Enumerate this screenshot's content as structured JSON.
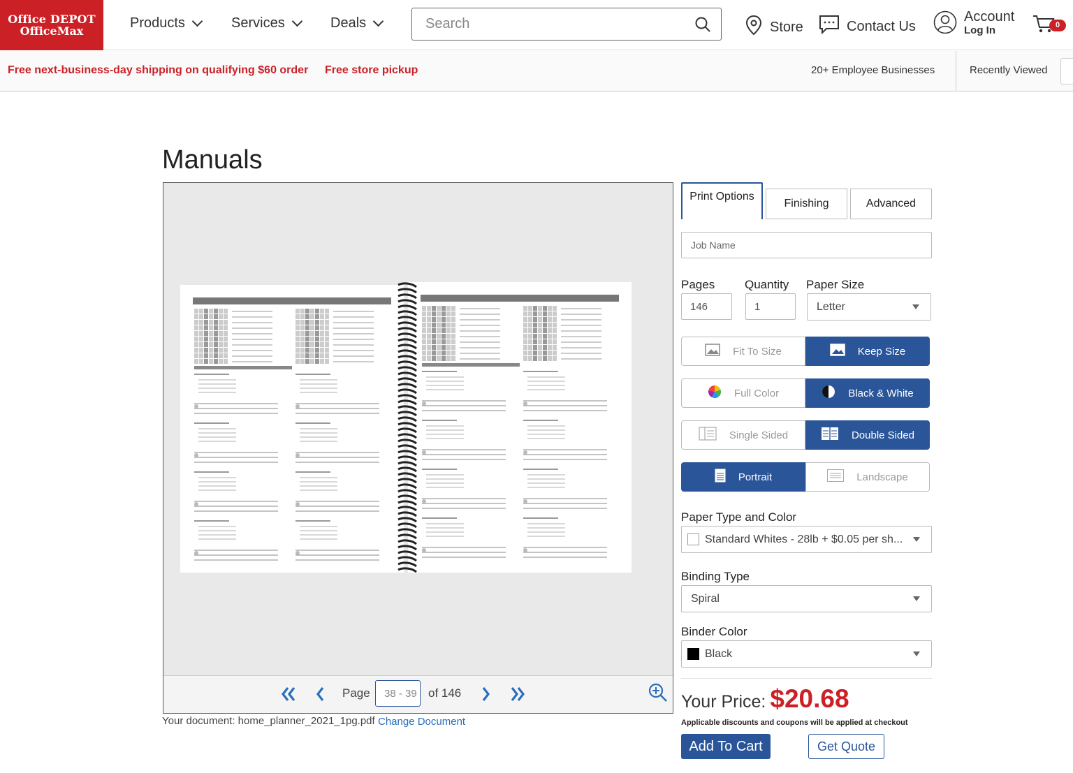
{
  "brand": {
    "line1": "Office DEPOT",
    "line2": "OfficeMax",
    "color": "#cc2027"
  },
  "nav": {
    "products": "Products",
    "services": "Services",
    "deals": "Deals"
  },
  "search": {
    "placeholder": "Search"
  },
  "header_links": {
    "store": "Store",
    "contact": "Contact Us",
    "account": "Account",
    "login": "Log In",
    "cart_count": "0"
  },
  "promo": {
    "shipping": "Free next-business-day shipping on qualifying $60 order",
    "pickup": "Free store pickup",
    "employee": "20+ Employee Businesses",
    "recent": "Recently Viewed"
  },
  "page": {
    "title": "Manuals"
  },
  "viewer": {
    "page_label": "Page",
    "page_value": "38 - 39",
    "of_label": "of 146",
    "document_label": "Your document: home_planner_2021_1pg.pdf",
    "change_document": "Change Document"
  },
  "tabs": [
    {
      "label": "Print Options",
      "active": true
    },
    {
      "label": "Finishing",
      "active": false
    },
    {
      "label": "Advanced",
      "active": false
    }
  ],
  "options": {
    "job_name_placeholder": "Job Name",
    "pages_label": "Pages",
    "pages_value": "146",
    "quantity_label": "Quantity",
    "quantity_value": "1",
    "paper_size_label": "Paper Size",
    "paper_size_value": "Letter",
    "fit": {
      "left": "Fit To Size",
      "right": "Keep Size",
      "selected": "right"
    },
    "color": {
      "left": "Full Color",
      "right": "Black & White",
      "selected": "right"
    },
    "sides": {
      "left": "Single Sided",
      "right": "Double Sided",
      "selected": "right"
    },
    "orientation": {
      "left": "Portrait",
      "right": "Landscape",
      "selected": "left"
    },
    "paper_type_label": "Paper Type and Color",
    "paper_type_value": "Standard Whites - 28lb + $0.05 per sh...",
    "binding_label": "Binding Type",
    "binding_value": "Spiral",
    "binder_color_label": "Binder Color",
    "binder_color_value": "Black"
  },
  "pricing": {
    "label": "Your Price:",
    "price": "$20.68",
    "note": "Applicable discounts and coupons will be applied at checkout",
    "add_to_cart": "Add To Cart",
    "get_quote": "Get Quote"
  },
  "colors": {
    "accent": "#2a5599",
    "brand_red": "#cc2027",
    "link": "#2a6ebb"
  }
}
